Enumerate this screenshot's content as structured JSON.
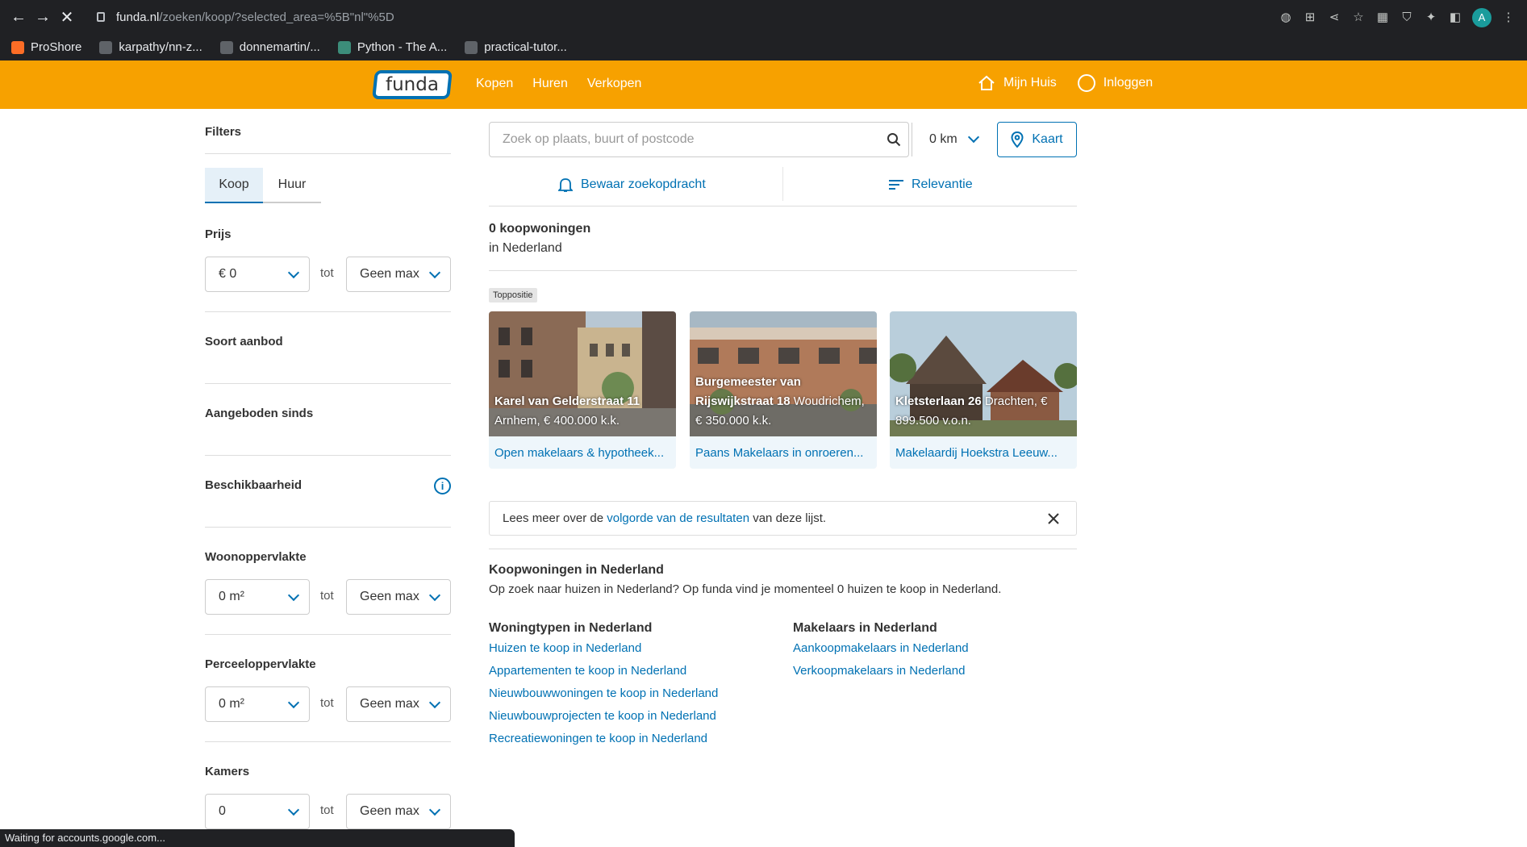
{
  "browser": {
    "url_host": "funda.nl",
    "url_path": "/zoeken/koop/?selected_area=%5B\"nl\"%5D",
    "profile_initial": "A",
    "bookmarks": [
      "ProShore",
      "karpathy/nn-z...",
      "donnemartin/...",
      "Python - The A...",
      "practical-tutor..."
    ],
    "status": "Waiting for accounts.google.com..."
  },
  "header": {
    "logo": "funda",
    "nav": [
      "Kopen",
      "Huren",
      "Verkopen"
    ],
    "mijn_huis": "Mijn Huis",
    "inloggen": "Inloggen",
    "brand_color": "#f7a100",
    "accent_color": "#0071b3"
  },
  "filters": {
    "title": "Filters",
    "tabs": [
      "Koop",
      "Huur"
    ],
    "prijs": {
      "title": "Prijs",
      "min": "€ 0",
      "tot": "tot",
      "max": "Geen max"
    },
    "soort_aanbod": "Soort aanbod",
    "aangeboden_sinds": "Aangeboden sinds",
    "beschikbaarheid": "Beschikbaarheid",
    "woonoppervlakte": {
      "title": "Woonoppervlakte",
      "min": "0 m²",
      "tot": "tot",
      "max": "Geen max"
    },
    "perceeloppervlakte": {
      "title": "Perceeloppervlakte",
      "min": "0 m²",
      "tot": "tot",
      "max": "Geen max"
    },
    "kamers": {
      "title": "Kamers",
      "min": "0",
      "tot": "tot",
      "max": "Geen max"
    }
  },
  "search": {
    "placeholder": "Zoek op plaats, buurt of postcode",
    "radius": "0 km",
    "kaart": "Kaart",
    "bewaar": "Bewaar zoekopdracht",
    "sort": "Relevantie"
  },
  "results": {
    "count": "0 koopwoningen",
    "location": "in Nederland",
    "toppositie": "Toppositie",
    "cards": [
      {
        "street": "Karel van Gelderstraat 11",
        "rest": "Arnhem, € 400.000 k.k.",
        "makelaar": "Open makelaars & hypotheek..."
      },
      {
        "street": "Burgemeester van Rijswijkstraat 18",
        "rest": "Woudrichem, € 350.000 k.k.",
        "makelaar": "Paans Makelaars in onroeren..."
      },
      {
        "street": "Kletsterlaan 26",
        "rest": "Drachten, € 899.500 v.o.n.",
        "makelaar": "Makelaardij Hoekstra Leeuw..."
      }
    ],
    "notice_pre": "Lees meer over de ",
    "notice_link": "volgorde van de resultaten",
    "notice_post": " van deze lijst."
  },
  "seo": {
    "title": "Koopwoningen in Nederland",
    "text": "Op zoek naar huizen in Nederland? Op funda vind je momenteel 0 huizen te koop in Nederland.",
    "woningtypen_title": "Woningtypen in Nederland",
    "woningtypen": [
      "Huizen te koop in Nederland",
      "Appartementen te koop in Nederland",
      "Nieuwbouwwoningen te koop in Nederland",
      "Nieuwbouwprojecten te koop in Nederland",
      "Recreatiewoningen te koop in Nederland"
    ],
    "makelaars_title": "Makelaars in Nederland",
    "makelaars": [
      "Aankoopmakelaars in Nederland",
      "Verkoopmakelaars in Nederland"
    ]
  }
}
